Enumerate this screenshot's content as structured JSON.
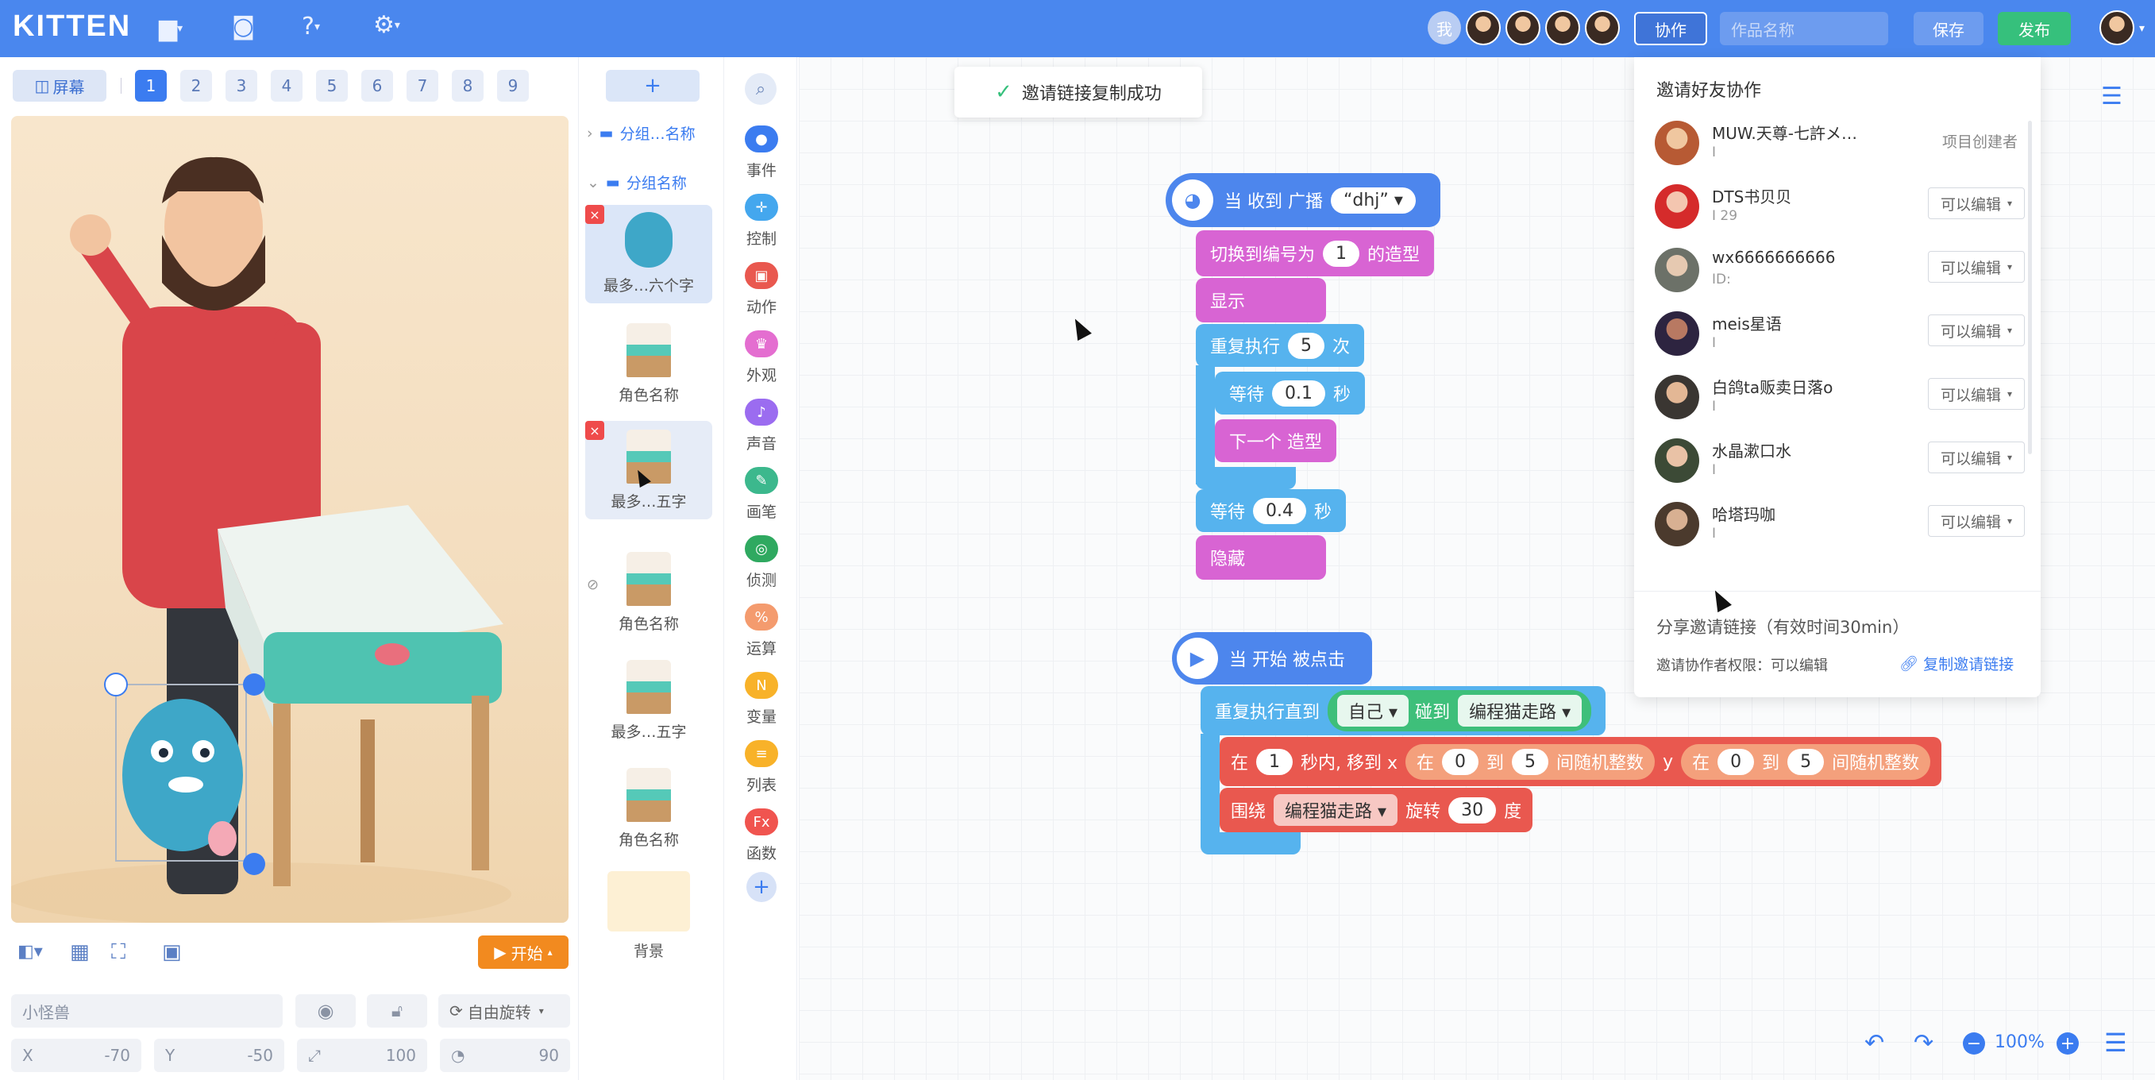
{
  "app": {
    "logo": "KITTEN"
  },
  "topbar": {
    "me_label": "我",
    "collab_button": "协作",
    "work_name_placeholder": "作品名称",
    "save_button": "保存",
    "publish_button": "发布"
  },
  "stage_toolbar": {
    "screen_button": "屏幕",
    "screens": [
      "1",
      "2",
      "3",
      "4",
      "5",
      "6",
      "7",
      "8",
      "9"
    ]
  },
  "stage_controls": {
    "start_button": "开始"
  },
  "sprite_props": {
    "name_value": "小怪兽",
    "rotate_mode": "自由旋转",
    "x_label": "X",
    "x_value": "-70",
    "y_label": "Y",
    "y_value": "-50",
    "size_value": "100",
    "direction_value": "90"
  },
  "sprite_list": {
    "add_button": "+",
    "group1": "分组…名称",
    "group2": "分组名称",
    "items": [
      "最多…六个字",
      "角色名称",
      "最多…五字",
      "角色名称",
      "最多…五字",
      "角色名称"
    ],
    "background_label": "背景"
  },
  "categories": [
    {
      "label": "事件",
      "color": "#3b7cf0"
    },
    {
      "label": "控制",
      "color": "#44a7ee"
    },
    {
      "label": "动作",
      "color": "#e9584f"
    },
    {
      "label": "外观",
      "color": "#e46ed0"
    },
    {
      "label": "声音",
      "color": "#9b6cf0"
    },
    {
      "label": "画笔",
      "color": "#3cb88d"
    },
    {
      "label": "侦测",
      "color": "#2fa960"
    },
    {
      "label": "运算",
      "color": "#f49b6e"
    },
    {
      "label": "变量",
      "color": "#f8b229"
    },
    {
      "label": "列表",
      "color": "#f8b229"
    },
    {
      "label": "函数",
      "color": "#f0544f"
    }
  ],
  "toast": {
    "text": "邀请链接复制成功"
  },
  "script1": {
    "hat": "当 收到 广播",
    "hat_value": "“dhj”",
    "switch_costume": "切换到编号为",
    "costume_num": "1",
    "costume_suffix": "的造型",
    "show": "显示",
    "repeat": "重复执行",
    "repeat_count": "5",
    "repeat_suffix": "次",
    "wait": "等待",
    "wait_value": "0.1",
    "wait_unit": "秒",
    "next_costume": "下一个 造型",
    "wait2_value": "0.4",
    "hide": "隐藏"
  },
  "script2": {
    "hat": "当 开始 被点击",
    "repeat_until": "重复执行直到",
    "self": "自己",
    "touch": "碰到",
    "target": "编程猫走路",
    "in": "在",
    "secs": "1",
    "move_to_x": "秒内, 移到 x",
    "rand_in": "在",
    "rand_from": "0",
    "rand_to_label": "到",
    "rand_to": "5",
    "rand_int": "间随机整数",
    "y_label": "y",
    "orbit": "围绕",
    "orbit_target": "编程猫走路",
    "rotate": "旋转",
    "deg": "30",
    "deg_unit": "度"
  },
  "collab_panel": {
    "title": "邀请好友协作",
    "members": [
      {
        "name": "MUW.天尊-七許メ…",
        "id": "I",
        "role": "项目创建者"
      },
      {
        "name": "DTS书贝贝",
        "id": "I      29",
        "perm": "可以编辑"
      },
      {
        "name": "wx6666666666",
        "id": "ID:",
        "perm": "可以编辑"
      },
      {
        "name": "meis星语",
        "id": "I",
        "perm": "可以编辑"
      },
      {
        "name": "白鸽ta贩卖日落o",
        "id": "I",
        "perm": "可以编辑"
      },
      {
        "name": "水晶漱口水",
        "id": "I",
        "perm": "可以编辑"
      },
      {
        "name": "哈塔玛咖",
        "id": "I",
        "perm": "可以编辑"
      }
    ],
    "share_title": "分享邀请链接（有效时间30min）",
    "perm_label": "邀请协作者权限：可以编辑",
    "copy_link": "复制邀请链接"
  },
  "zoom": {
    "level": "100%"
  }
}
